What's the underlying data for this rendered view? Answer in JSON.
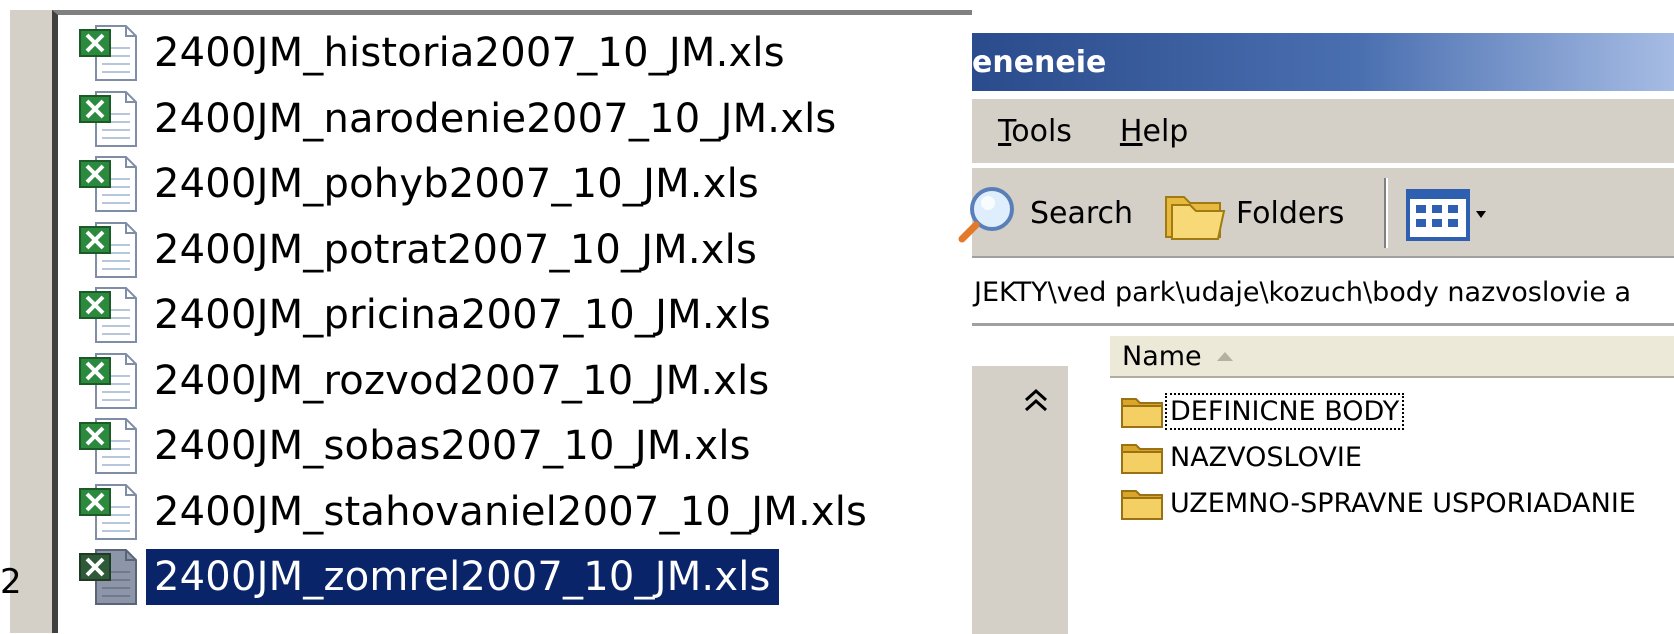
{
  "left_fragment": "2",
  "file_list": {
    "files": [
      {
        "name": "2400JM_historia2007_10_JM.xls",
        "selected": false
      },
      {
        "name": "2400JM_narodenie2007_10_JM.xls",
        "selected": false
      },
      {
        "name": "2400JM_pohyb2007_10_JM.xls",
        "selected": false
      },
      {
        "name": "2400JM_potrat2007_10_JM.xls",
        "selected": false
      },
      {
        "name": "2400JM_pricina2007_10_JM.xls",
        "selected": false
      },
      {
        "name": "2400JM_rozvod2007_10_JM.xls",
        "selected": false
      },
      {
        "name": "2400JM_sobas2007_10_JM.xls",
        "selected": false
      },
      {
        "name": "2400JM_stahovaniel2007_10_JM.xls",
        "selected": false
      },
      {
        "name": "2400JM_zomrel2007_10_JM.xls",
        "selected": true
      }
    ],
    "icon": "excel-file-icon"
  },
  "explorer": {
    "title": "eneneie",
    "menu": [
      "Tools",
      "Help"
    ],
    "toolbar": {
      "search_label": "Search",
      "folders_label": "Folders",
      "views_icon": "views-icon"
    },
    "address": "JEKTY\\ved park\\udaje\\kozuch\\body nazvoslovie a",
    "column_name": "Name",
    "folders": [
      {
        "name": "DEFINICNE BODY",
        "focused": true
      },
      {
        "name": "NAZVOSLOVIE",
        "focused": false
      },
      {
        "name": "UZEMNO-SPRAVNE USPORIADANIE",
        "focused": false
      }
    ]
  },
  "colors": {
    "selection": "#0a246a",
    "titlebar": "#2a4b8c",
    "chrome": "#d4d0c8"
  }
}
